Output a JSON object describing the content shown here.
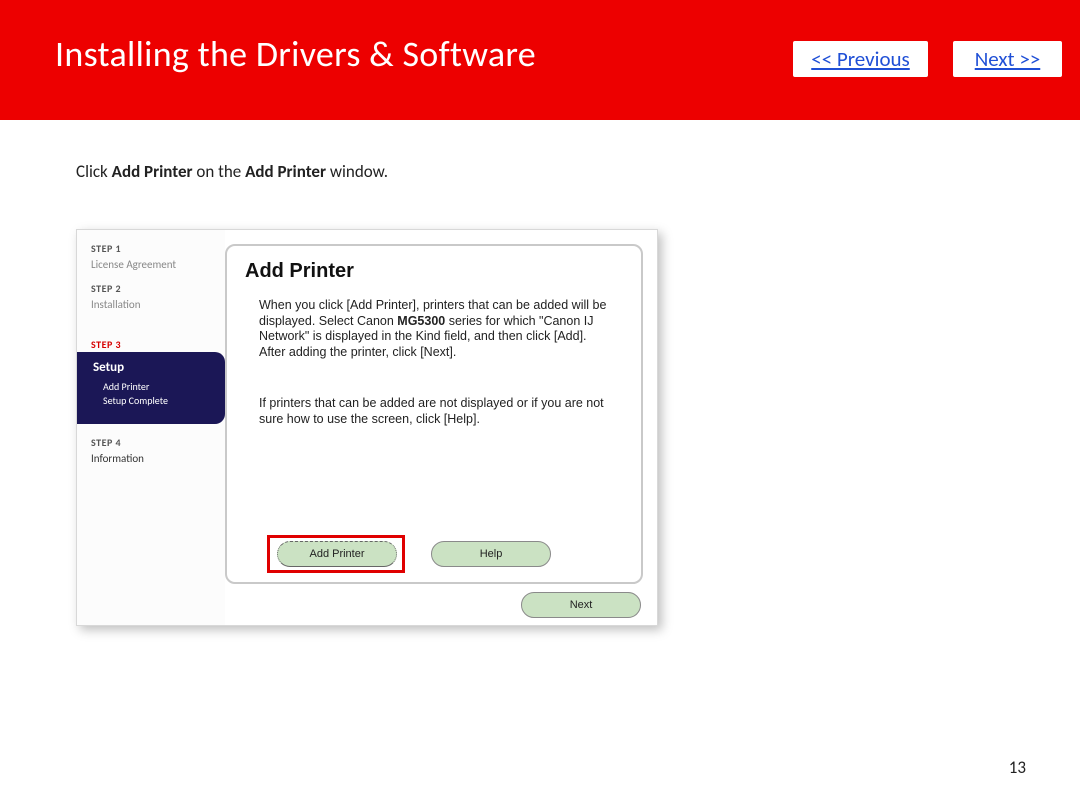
{
  "header": {
    "title": "Installing the Drivers & Software",
    "previous": "<< Previous",
    "next": "Next >>"
  },
  "instruction": {
    "pre": "Click ",
    "bold1": "Add Printer",
    "mid": " on the  ",
    "bold2": "Add Printer",
    "post": " window."
  },
  "wizard": {
    "sidebar": {
      "step1_label": "STEP 1",
      "step1_item": "License Agreement",
      "step2_label": "STEP 2",
      "step2_item": "Installation",
      "step3_label": "STEP 3",
      "step3_title": "Setup",
      "step3_sub1": "Add Printer",
      "step3_sub2": "Setup Complete",
      "step4_label": "STEP 4",
      "step4_item": "Information"
    },
    "main": {
      "heading": "Add Printer",
      "p1_a": "When you click [Add Printer], printers that can be added will be displayed. Select Canon ",
      "p1_bold": "MG5300",
      "p1_b": " series for which \"Canon IJ Network\" is displayed in the Kind field, and then click [Add]. After adding the printer, click [Next].",
      "p2": "If printers that can be added are not displayed or if you are not sure how to use the screen, click [Help].",
      "btn_add": "Add Printer",
      "btn_help": "Help",
      "btn_next": "Next"
    }
  },
  "page_number": "13"
}
